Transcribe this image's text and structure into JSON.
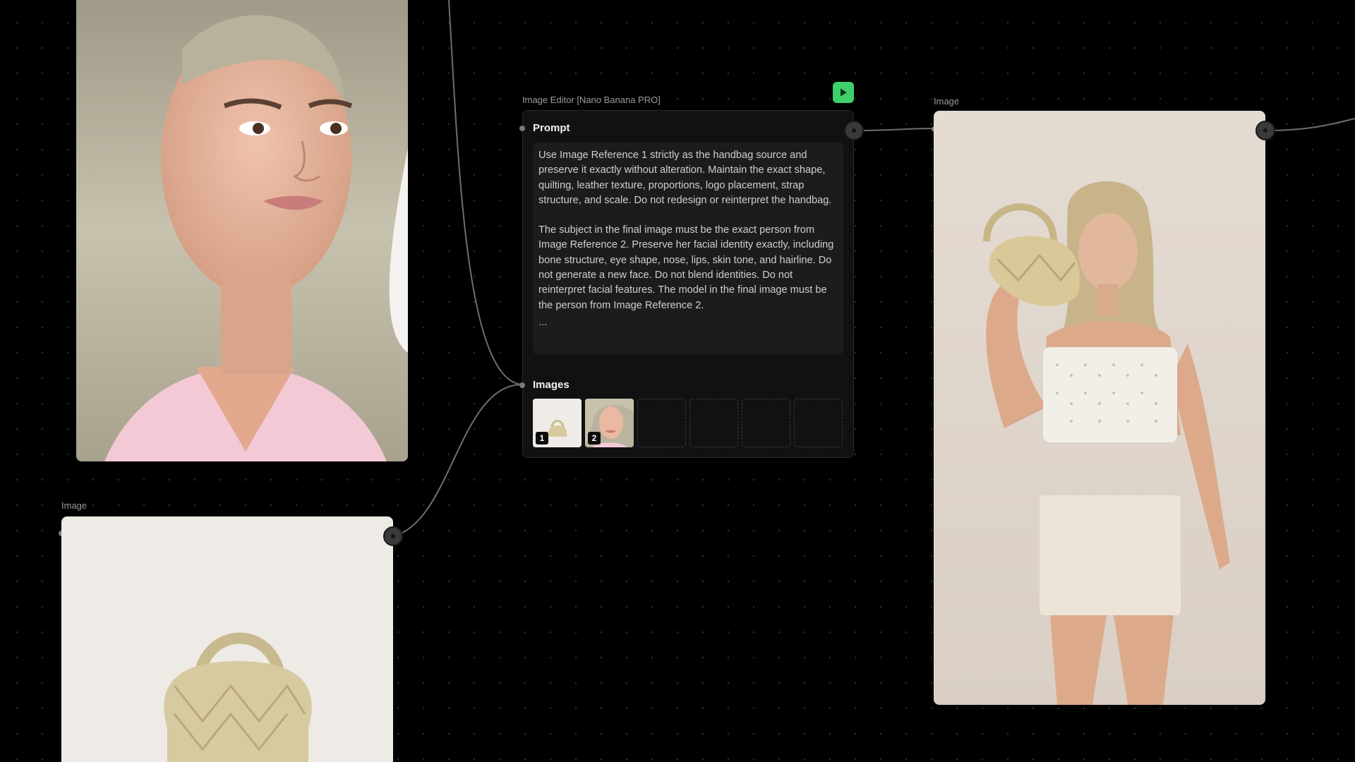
{
  "colors": {
    "canvas_bg": "#000000",
    "node_bg": "#111111",
    "prompt_bg": "#1c1c1c",
    "run_button": "#3fcf6b",
    "edge": "#6e6e6e"
  },
  "nodes": {
    "editor": {
      "title": "Image Editor [Nano Banana PRO]",
      "run_icon": "play-icon",
      "prompt_label": "Prompt",
      "prompt_paragraphs": [
        "Use Image Reference 1 strictly as the handbag source and preserve it exactly without alteration. Maintain the exact shape, quilting, leather texture, proportions, logo placement, strap structure, and scale. Do not redesign or reinterpret the handbag.",
        "The subject in the final image must be the exact person from Image Reference 2. Preserve her facial identity exactly, including bone structure, eye shape, nose, lips, skin tone, and hairline. Do not generate a new face. Do not blend identities. Do not reinterpret facial features. The model in the final image must be the person from Image Reference 2."
      ],
      "prompt_more": "...",
      "images_label": "Images",
      "image_slots": [
        {
          "number": "1",
          "filled": true,
          "content": "handbag"
        },
        {
          "number": "2",
          "filled": true,
          "content": "portrait"
        },
        {
          "filled": false
        },
        {
          "filled": false
        },
        {
          "filled": false
        },
        {
          "filled": false
        }
      ]
    },
    "handbag_image": {
      "label": "Image",
      "content": "gold quilted handbag on cream background"
    },
    "output_image": {
      "label": "Image",
      "content": "model holding gold handbag, white crop top and skirt"
    },
    "portrait_image": {
      "content": "portrait of blonde woman"
    }
  }
}
